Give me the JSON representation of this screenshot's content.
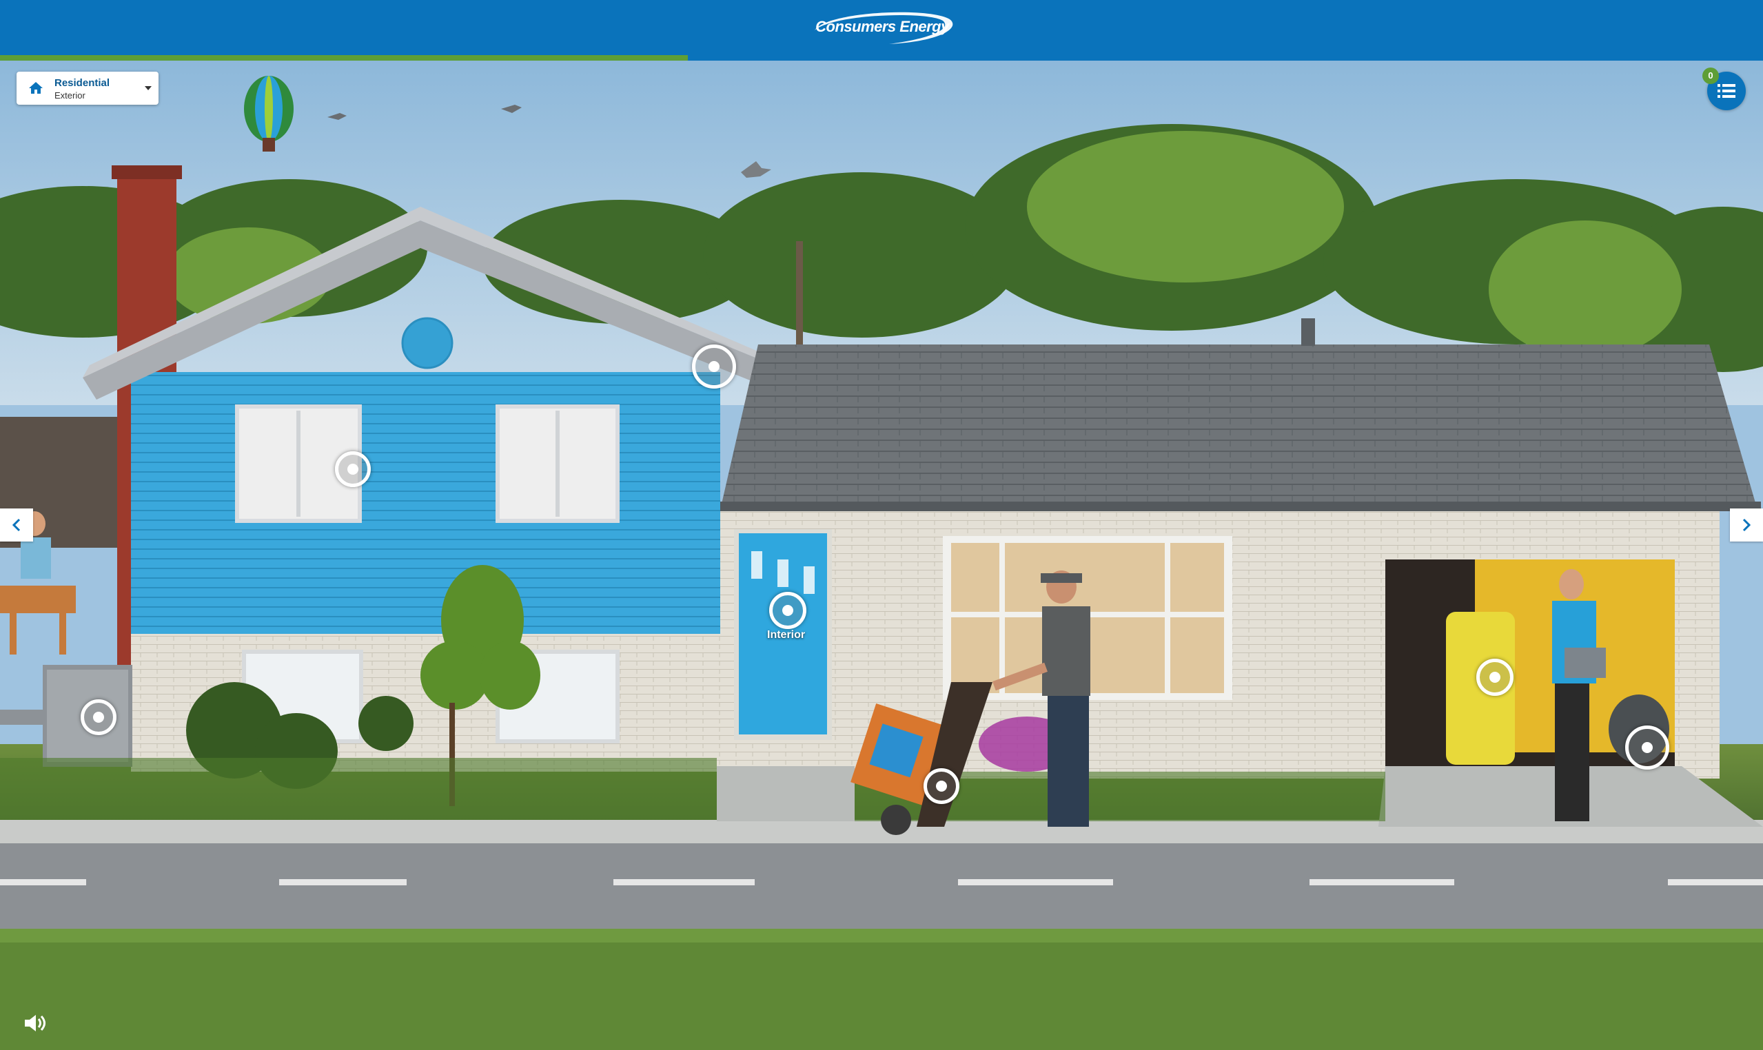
{
  "header": {
    "logo_text": "Consumers Energy",
    "progress_fraction": 0.39,
    "bar_color": "#0a73bb",
    "progress_color": "#5e9e36"
  },
  "section_select": {
    "title": "Residential",
    "subtitle": "Exterior",
    "icon": "home-icon"
  },
  "checklist": {
    "count": "0",
    "icon": "list-icon"
  },
  "navigation": {
    "prev_icon": "chevron-left-icon",
    "next_icon": "chevron-right-icon"
  },
  "hotspots": {
    "interior_label": "Interior"
  },
  "sound": {
    "icon": "speaker-icon"
  }
}
